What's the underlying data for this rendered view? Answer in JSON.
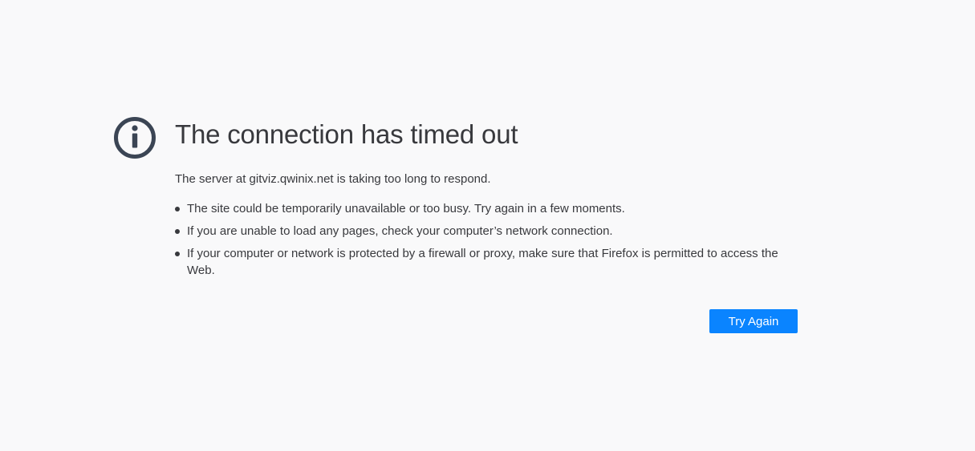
{
  "error": {
    "icon": "info-icon",
    "title": "The connection has timed out",
    "message": "The server at gitviz.qwinix.net is taking too long to respond.",
    "suggestions": [
      "The site could be temporarily unavailable or too busy. Try again in a few moments.",
      "If you are unable to load any pages, check your computer’s network connection.",
      "If your computer or network is protected by a firewall or proxy, make sure that Firefox is permitted to access the Web."
    ],
    "retry_label": "Try Again"
  },
  "colors": {
    "background": "#f9f9fa",
    "text": "#38393d",
    "icon": "#3b4554",
    "button": "#0a84ff"
  }
}
